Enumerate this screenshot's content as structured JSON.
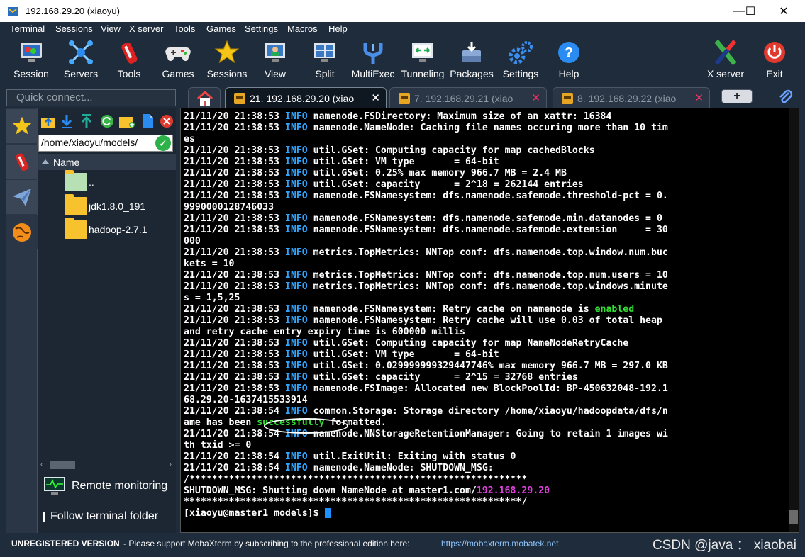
{
  "window": {
    "title": "192.168.29.20 (xiaoyu)",
    "minimize": "—",
    "maximize": "☐",
    "close": "✕"
  },
  "menu": [
    "Terminal",
    "Sessions",
    "View",
    "X server",
    "Tools",
    "Games",
    "Settings",
    "Macros",
    "Help"
  ],
  "toolbar": [
    {
      "label": "Session",
      "icon": "session-icon"
    },
    {
      "label": "Servers",
      "icon": "servers-icon"
    },
    {
      "label": "Tools",
      "icon": "tools-icon"
    },
    {
      "label": "Games",
      "icon": "games-icon"
    },
    {
      "label": "Sessions",
      "icon": "sessions-star-icon"
    },
    {
      "label": "View",
      "icon": "view-icon"
    },
    {
      "label": "Split",
      "icon": "split-icon"
    },
    {
      "label": "MultiExec",
      "icon": "multiexec-icon"
    },
    {
      "label": "Tunneling",
      "icon": "tunneling-icon"
    },
    {
      "label": "Packages",
      "icon": "packages-icon"
    },
    {
      "label": "Settings",
      "icon": "settings-gear-icon"
    },
    {
      "label": "Help",
      "icon": "help-icon"
    },
    {
      "label": "X server",
      "icon": "xserver-icon"
    },
    {
      "label": "Exit",
      "icon": "exit-power-icon"
    }
  ],
  "quick_connect": {
    "placeholder": "Quick connect..."
  },
  "tabs": [
    {
      "label": "21. 192.168.29.20 (xiao"
    },
    {
      "label": "7. 192.168.29.21 (xiao"
    },
    {
      "label": "8. 192.168.29.22 (xiao"
    }
  ],
  "sftp": {
    "path": "/home/xiaoyu/models/",
    "column": "Name",
    "files": [
      {
        "name": ".."
      },
      {
        "name": "jdk1.8.0_191"
      },
      {
        "name": "hadoop-2.7.1"
      }
    ],
    "remote_monitoring": "Remote monitoring",
    "follow_terminal": "Follow terminal folder"
  },
  "terminal": {
    "lines": [
      {
        "ts": "21/11/20 21:38:53 ",
        "lvl": "INFO",
        "msg": " namenode.FSDirectory: Maximum size of an xattr: 16384"
      },
      {
        "ts": "21/11/20 21:38:53 ",
        "lvl": "INFO",
        "msg": " namenode.NameNode: Caching file names occuring more than 10 tim"
      },
      {
        "ts": "",
        "lvl": "",
        "msg": "es"
      },
      {
        "ts": "21/11/20 21:38:53 ",
        "lvl": "INFO",
        "msg": " util.GSet: Computing capacity for map cachedBlocks"
      },
      {
        "ts": "21/11/20 21:38:53 ",
        "lvl": "INFO",
        "msg": " util.GSet: VM type       = 64-bit"
      },
      {
        "ts": "21/11/20 21:38:53 ",
        "lvl": "INFO",
        "msg": " util.GSet: 0.25% max memory 966.7 MB = 2.4 MB"
      },
      {
        "ts": "21/11/20 21:38:53 ",
        "lvl": "INFO",
        "msg": " util.GSet: capacity      = 2^18 = 262144 entries"
      },
      {
        "ts": "21/11/20 21:38:53 ",
        "lvl": "INFO",
        "msg": " namenode.FSNamesystem: dfs.namenode.safemode.threshold-pct = 0."
      },
      {
        "ts": "",
        "lvl": "",
        "msg": "9990000128746033"
      },
      {
        "ts": "21/11/20 21:38:53 ",
        "lvl": "INFO",
        "msg": " namenode.FSNamesystem: dfs.namenode.safemode.min.datanodes = 0"
      },
      {
        "ts": "21/11/20 21:38:53 ",
        "lvl": "INFO",
        "msg": " namenode.FSNamesystem: dfs.namenode.safemode.extension     = 30"
      },
      {
        "ts": "",
        "lvl": "",
        "msg": "000"
      },
      {
        "ts": "21/11/20 21:38:53 ",
        "lvl": "INFO",
        "msg": " metrics.TopMetrics: NNTop conf: dfs.namenode.top.window.num.buc"
      },
      {
        "ts": "",
        "lvl": "",
        "msg": "kets = 10"
      },
      {
        "ts": "21/11/20 21:38:53 ",
        "lvl": "INFO",
        "msg": " metrics.TopMetrics: NNTop conf: dfs.namenode.top.num.users = 10"
      },
      {
        "ts": "21/11/20 21:38:53 ",
        "lvl": "INFO",
        "msg": " metrics.TopMetrics: NNTop conf: dfs.namenode.top.windows.minute"
      },
      {
        "ts": "",
        "lvl": "",
        "msg": "s = 1,5,25"
      },
      {
        "ts": "21/11/20 21:38:53 ",
        "lvl": "INFO",
        "msg": " namenode.FSNamesystem: Retry cache on namenode is ",
        "hl": "enabled"
      },
      {
        "ts": "21/11/20 21:38:53 ",
        "lvl": "INFO",
        "msg": " namenode.FSNamesystem: Retry cache will use 0.03 of total heap"
      },
      {
        "ts": "",
        "lvl": "",
        "msg": "and retry cache entry expiry time is 600000 millis"
      },
      {
        "ts": "21/11/20 21:38:53 ",
        "lvl": "INFO",
        "msg": " util.GSet: Computing capacity for map NameNodeRetryCache"
      },
      {
        "ts": "21/11/20 21:38:53 ",
        "lvl": "INFO",
        "msg": " util.GSet: VM type       = 64-bit"
      },
      {
        "ts": "21/11/20 21:38:53 ",
        "lvl": "INFO",
        "msg": " util.GSet: 0.029999999329447746% max memory 966.7 MB = 297.0 KB"
      },
      {
        "ts": "21/11/20 21:38:53 ",
        "lvl": "INFO",
        "msg": " util.GSet: capacity      = 2^15 = 32768 entries"
      },
      {
        "ts": "21/11/20 21:38:53 ",
        "lvl": "INFO",
        "msg": " namenode.FSImage: Allocated new BlockPoolId: BP-450632048-192.1"
      },
      {
        "ts": "",
        "lvl": "",
        "msg": "68.29.20-1637415533914"
      },
      {
        "ts": "21/11/20 21:38:54 ",
        "lvl": "INFO",
        "msg": " common.Storage: Storage directory /home/xiaoyu/hadoopdata/dfs/n"
      },
      {
        "ts": "",
        "lvl": "",
        "msg": "ame has been ",
        "hl": "successfully",
        "msg2": " formatted."
      },
      {
        "ts": "21/11/20 21:38:54 ",
        "lvl": "INFO",
        "msg": " namenode.NNStorageRetentionManager: Going to retain 1 images wi"
      },
      {
        "ts": "",
        "lvl": "",
        "msg": "th txid >= 0"
      },
      {
        "ts": "21/11/20 21:38:54 ",
        "lvl": "INFO",
        "msg": " util.ExitUtil: Exiting with status 0"
      },
      {
        "ts": "21/11/20 21:38:54 ",
        "lvl": "INFO",
        "msg": " namenode.NameNode: SHUTDOWN_MSG:"
      },
      {
        "ts": "",
        "lvl": "",
        "msg": "/************************************************************"
      },
      {
        "ts": "",
        "lvl": "",
        "msg": "SHUTDOWN_MSG: Shutting down NameNode at master1.com/",
        "ip": "192.168.29.20"
      },
      {
        "ts": "",
        "lvl": "",
        "msg": "************************************************************/"
      },
      {
        "ts": "",
        "lvl": "",
        "msg": "[xiaoyu@master1 models]$ ",
        "cursor": true
      }
    ]
  },
  "status": {
    "unregistered": "UNREGISTERED VERSION",
    "message": "-  Please support MobaXterm by subscribing to the professional edition here:",
    "url": "https://mobaxterm.mobatek.net",
    "watermark": "CSDN @java ： xiaobai"
  },
  "colors": {
    "info": "#2ea6ff",
    "enabled": "#33dd33",
    "ip": "#e040e0",
    "cursor": "#1e90ff"
  }
}
